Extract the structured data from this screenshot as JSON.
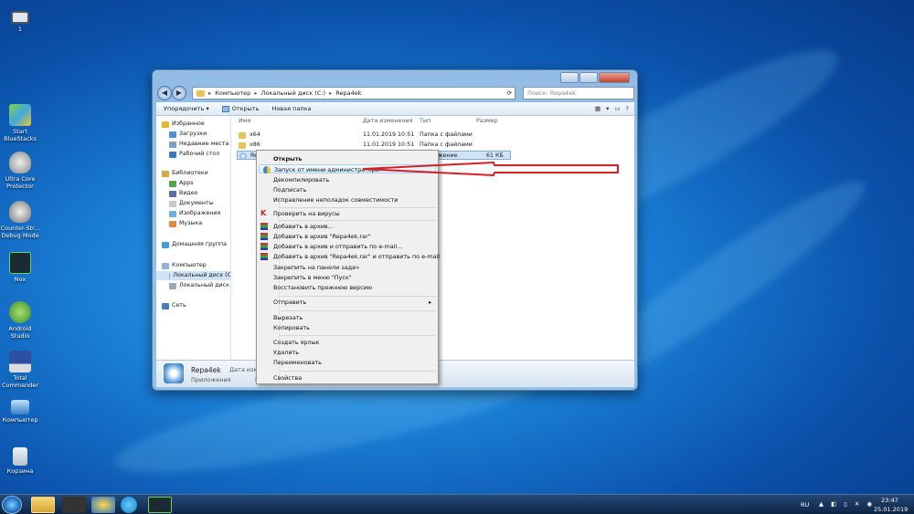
{
  "desktop": {
    "icons": [
      {
        "label": "1"
      },
      {
        "label": "Start BlueStacks"
      },
      {
        "label": "Ultra Core Protector"
      },
      {
        "label": "Counter-Str... Debug Mode"
      },
      {
        "label": "Nox"
      },
      {
        "label": "Android Studio"
      },
      {
        "label": "Total Commander"
      },
      {
        "label": "Компьютер"
      },
      {
        "label": "Корзина"
      }
    ]
  },
  "explorer": {
    "address": {
      "crumbs": [
        "Компьютер",
        "Локальный диск (C:)",
        "Repa4ek"
      ]
    },
    "search_placeholder": "Поиск: Repa4ek",
    "toolbar": {
      "organize": "Упорядочить ▾",
      "open": "Открыть",
      "new_folder": "Новая папка"
    },
    "nav": {
      "favorites": "Избранное",
      "downloads": "Загрузки",
      "recent": "Недавние места",
      "desktop": "Рабочий стол",
      "libraries": "Библиотеки",
      "apps": "Apps",
      "video": "Видео",
      "documents": "Документы",
      "images": "Изображения",
      "music": "Музыка",
      "homegroup": "Домашняя группа",
      "computer": "Компьютер",
      "local_c": "Локальный диск (C",
      "local_d": "Локальный диск (D",
      "network": "Сеть"
    },
    "columns": {
      "name": "Имя",
      "date": "Дата изменения",
      "type": "Тип",
      "size": "Размер"
    },
    "rows": [
      {
        "name": "x64",
        "date": "11.01.2019 10:51",
        "type": "Папка с файлами",
        "size": ""
      },
      {
        "name": "x86",
        "date": "11.01.2019 10:51",
        "type": "Папка с файлами",
        "size": ""
      },
      {
        "name": "Repa",
        "date": "",
        "type": "ожение",
        "size": "61 КБ"
      }
    ],
    "details": {
      "name": "Repa4ek",
      "type": "Приложения",
      "date_label": "Дата изменен",
      "letter": "Р"
    }
  },
  "context_menu": {
    "items": {
      "open": "Открыть",
      "run_as_admin": "Запуск от имени администратора",
      "decompile": "Декомпилировать",
      "sign": "Подписать",
      "troubleshoot": "Исправление неполадок совместимости",
      "scan": "Проверить на вирусы",
      "add_archive": "Добавить в архив...",
      "add_rar": "Добавить в архив \"Repa4ek.rar\"",
      "add_email": "Добавить в архив и отправить по e-mail...",
      "add_rar_email": "Добавить в архив \"Repa4ek.rar\" и отправить по e-mail",
      "pin_taskbar": "Закрепить на панели задач",
      "pin_start": "Закрепить в меню \"Пуск\"",
      "restore": "Восстановить прежнюю версию",
      "send_to": "Отправить",
      "cut": "Вырезать",
      "copy": "Копировать",
      "shortcut": "Создать ярлык",
      "delete": "Удалить",
      "rename": "Переименовать",
      "properties": "Свойства"
    },
    "arrow": "▸"
  },
  "annotation": {
    "color": "#d42020"
  },
  "taskbar": {
    "lang": "RU",
    "time": "23:47",
    "date": "25.01.2019"
  }
}
